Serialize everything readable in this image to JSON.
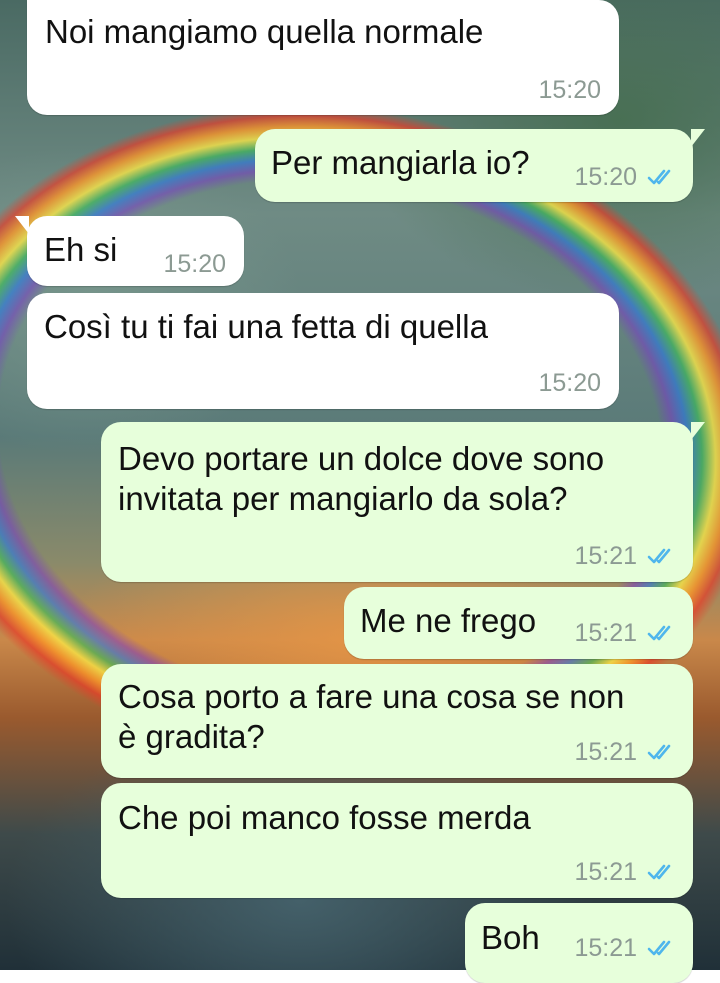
{
  "chat": {
    "messages": [
      {
        "text": "Noi mangiamo quella normale",
        "time": "15:20"
      },
      {
        "text": "Per mangiarla io?",
        "time": "15:20"
      },
      {
        "text": "Eh si",
        "time": "15:20"
      },
      {
        "text": "Così tu ti fai una fetta di quella",
        "time": "15:20"
      },
      {
        "text": "Devo portare un dolce dove sono\ninvitata per mangiarlo da sola?",
        "time": "15:21"
      },
      {
        "text": "Me ne frego",
        "time": "15:21"
      },
      {
        "text": "Cosa porto a fare una cosa se non\nè gradita?",
        "time": "15:21"
      },
      {
        "text": "Che poi manco fosse merda",
        "time": "15:21"
      },
      {
        "text": "Boh",
        "time": "15:21"
      }
    ]
  },
  "colors": {
    "incoming_bubble": "#ffffff",
    "outgoing_bubble": "#e7ffdb",
    "read_ticks": "#4fb6ec",
    "timestamp": "#8c9a93"
  },
  "icons": {
    "read_receipt": "double-check-icon"
  }
}
